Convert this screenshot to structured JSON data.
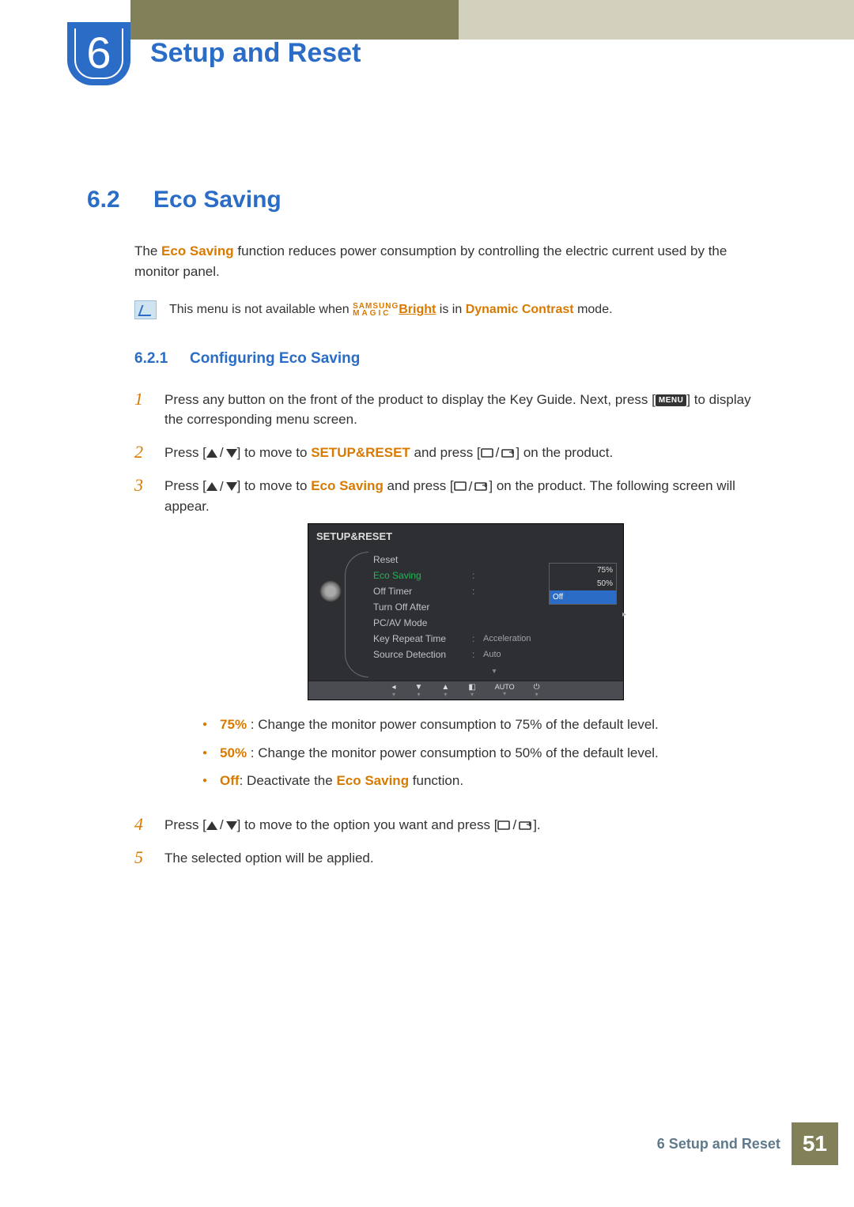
{
  "chapter": {
    "number": "6",
    "title": "Setup and Reset"
  },
  "section": {
    "number": "6.2",
    "title": "Eco Saving"
  },
  "intro": {
    "prefix": "The ",
    "feature": "Eco Saving",
    "suffix": " function reduces power consumption by controlling the electric current used by the monitor panel."
  },
  "note": {
    "t1": "This menu is not available when ",
    "magic_top": "SAMSUNG",
    "magic_bot": "MAGIC",
    "bright": "Bright",
    "t2": " is in ",
    "dc": "Dynamic Contrast",
    "t3": " mode."
  },
  "subsection": {
    "number": "6.2.1",
    "title": "Configuring Eco Saving"
  },
  "steps": {
    "s1a": "Press any button on the front of the product to display the Key Guide. Next, press [",
    "menu_badge": "MENU",
    "s1b": "] to display the corresponding menu screen.",
    "s2a": "Press [",
    "s2b": "] to move to ",
    "setup_reset": "SETUP&RESET",
    "s2c": " and press [",
    "s2d": "] on the product.",
    "s3a": "Press [",
    "s3b": "] to move to ",
    "eco": "Eco Saving",
    "s3c": " and press [",
    "s3d": "] on the product. The following screen will appear.",
    "s4a": "Press [",
    "s4b": "] to move to the option you want and press [",
    "s4c": "].",
    "s5": "The selected option will be applied."
  },
  "bullets": {
    "b1_bold": "75%",
    "b1_text": " : Change the monitor power consumption to 75% of the default level.",
    "b2_bold": "50%",
    "b2_text": " : Change the monitor power consumption to 50% of the default level.",
    "b3_bold": "Off",
    "b3_t1": ": Deactivate the ",
    "b3_eco": "Eco Saving",
    "b3_t2": " function."
  },
  "osd": {
    "title": "SETUP&RESET",
    "rows": {
      "reset": "Reset",
      "eco": "Eco Saving",
      "off_timer": "Off Timer",
      "turn_off": "Turn Off After",
      "pcav": "PC/AV Mode",
      "krt": "Key Repeat Time",
      "krt_val": "Acceleration",
      "sd": "Source Detection",
      "sd_val": "Auto"
    },
    "options": {
      "o1": "75%",
      "o2": "50%",
      "sel": "Off"
    },
    "footer": {
      "auto": "AUTO"
    }
  },
  "footer": {
    "text": "6 Setup and Reset",
    "page": "51"
  }
}
